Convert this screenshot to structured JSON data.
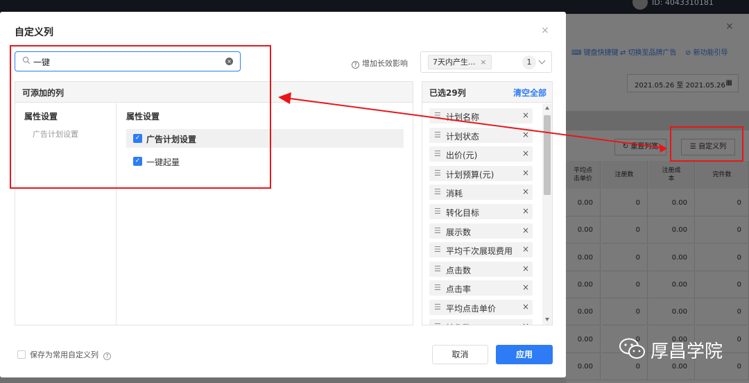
{
  "background": {
    "user_id": "ID: 4043310181",
    "close_icon": "×",
    "links": [
      "键盘快捷键",
      "切换至品牌广告",
      "新功能引导"
    ],
    "date_range": "2021.05.26 至 2021.05.26",
    "reset_label": "重置列宽",
    "custom_label": "自定义列",
    "table_headers": [
      "平均点\n击单价",
      "注册数",
      "注册成\n本",
      "完件数"
    ],
    "table_rows": [
      [
        "0.00",
        "0",
        "0.00",
        "0"
      ],
      [
        "0.00",
        "0",
        "0.00",
        "0"
      ],
      [
        "0.00",
        "0",
        "0.00",
        "0"
      ],
      [
        "0.00",
        "0",
        "0.00",
        "0"
      ],
      [
        "0.00",
        "0",
        "0.00",
        "0"
      ],
      [
        "0.00",
        "0",
        "0.00",
        "0"
      ],
      [
        "0.00",
        "0",
        "0.00",
        "0"
      ]
    ]
  },
  "dialog": {
    "title": "自定义列",
    "close_icon": "×",
    "search": {
      "value": "一键",
      "placeholder": ""
    },
    "extend_help": "增加长效影响",
    "tag_select": {
      "tag": "7天内产生...",
      "count": "1"
    },
    "available": {
      "header": "可添加的列",
      "category_title": "属性设置",
      "category_sub": "广告计划设置",
      "list_title": "属性设置",
      "options": [
        {
          "label": "广告计划设置",
          "checked": true,
          "highlight": true
        },
        {
          "label": "一键起量",
          "checked": true,
          "highlight": false
        }
      ]
    },
    "selected": {
      "count_label": "已选29列",
      "clear_all": "清空全部",
      "items": [
        "计划名称",
        "计划状态",
        "出价(元)",
        "计划预算(元)",
        "消耗",
        "转化目标",
        "展示数",
        "平均千次展现费用",
        "点击数",
        "点击率",
        "平均点击单价",
        "转化数"
      ]
    },
    "save_pref": "保存为常用自定义列",
    "cancel_label": "取消",
    "apply_label": "应用"
  },
  "annotations": {
    "color": "#e8161a"
  },
  "brand": {
    "text": "厚昌学院"
  }
}
